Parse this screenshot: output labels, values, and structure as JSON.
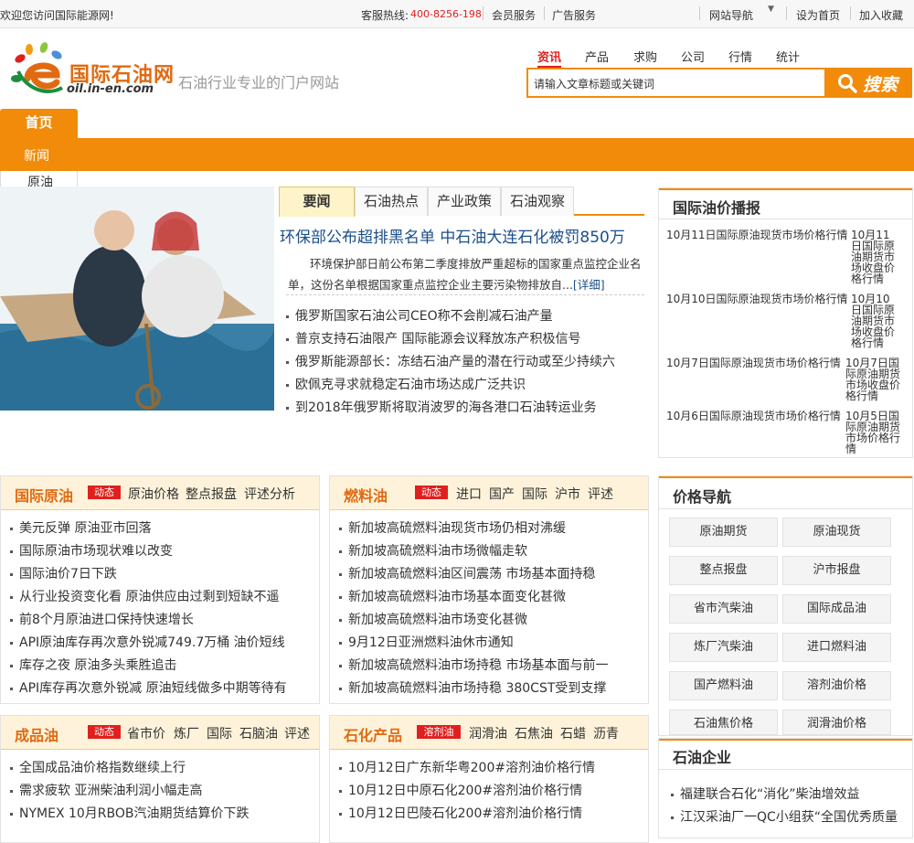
{
  "topbar": {
    "welcome": "欢迎您访问国际能源网!",
    "hotline_label": "客服热线:",
    "hotline": "400-8256-198",
    "member": "会员服务",
    "ads": "广告服务",
    "site_nav": "网站导航",
    "set_home": "设为首页",
    "bookmark": "加入收藏"
  },
  "logo": {
    "name": "国际石油网",
    "domain": "oil.in-en.com"
  },
  "slogan": "石油行业专业的门户网站",
  "search": {
    "tabs": [
      "资讯",
      "产品",
      "求购",
      "公司",
      "行情",
      "统计"
    ],
    "placeholder": "请输入文章标题或关键词",
    "button": "搜索"
  },
  "nav": {
    "home": "首页",
    "sub": [
      "新闻",
      "原油"
    ]
  },
  "headline": {
    "tabs": [
      "要闻",
      "石油热点",
      "产业政策",
      "石油观察"
    ],
    "title": "环保部公布超排黑名单 中石油大连石化被罚850万",
    "summary_line1": "环境保护部日前公布第二季度排放严重超标的国家重点监控企业名",
    "summary_line2": "单，这份名单根据国家重点监控企业主要污染物排放自...",
    "more": "[详细]",
    "items": [
      "俄罗斯国家石油公司CEO称不会削减石油产量",
      "普京支持石油限产 国际能源会议释放冻产积极信号",
      "俄罗斯能源部长：冻结石油产量的潜在行动或至少持续六",
      "欧佩克寻求就稳定石油市场达成广泛共识",
      "到2018年俄罗斯将取消波罗的海各港口石油转运业务"
    ]
  },
  "oil_price_broadcast": {
    "title": "国际油价播报",
    "rows": [
      {
        "left": "10月11日国际原油现货市场价格行情",
        "right": "10月11日国际原油期货市场收盘价格行情"
      },
      {
        "left": "10月10日国际原油现货市场价格行情",
        "right": "10月10日国际原油期货市场收盘价格行情"
      },
      {
        "left": "10月7日国际原油现货市场价格行情",
        "right": "10月7日国际原油期货市场收盘价格行情"
      },
      {
        "left": "10月6日国际原油现货市场价格行情",
        "right": "10月5日国际原油期货市场价格行情"
      }
    ]
  },
  "crude": {
    "title": "国际原油",
    "badge": "动态",
    "links": [
      "原油价格",
      "整点报盘",
      "评述分析"
    ],
    "items": [
      "美元反弹 原油亚市回落",
      "国际原油市场现状难以改变",
      "国际油价7日下跌",
      "从行业投资变化看 原油供应由过剩到短缺不遥",
      "前8个月原油进口保持快速增长",
      "API原油库存再次意外锐减749.7万桶 油价短线",
      "库存之夜 原油多头乘胜追击",
      "API库存再次意外锐减 原油短线做多中期等待有"
    ]
  },
  "fuel": {
    "title": "燃料油",
    "badge": "动态",
    "links": [
      "进口",
      "国产",
      "国际",
      "沪市",
      "评述"
    ],
    "items": [
      "新加坡高硫燃料油现货市场仍相对沸缓",
      "新加坡高硫燃料油市场微幅走软",
      "新加坡高硫燃料油区间震荡 市场基本面持稳",
      "新加坡高硫燃料油市场基本面变化甚微",
      "新加坡高硫燃料油市场变化甚微",
      "9月12日亚洲燃料油休市通知",
      "新加坡高硫燃料油市场持稳 市场基本面与前一",
      "新加坡高硫燃料油市场持稳 380CST受到支撑"
    ]
  },
  "price_nav": {
    "title": "价格导航",
    "buttons": [
      "原油期货",
      "原油现货",
      "整点报盘",
      "沪市报盘",
      "省市汽柴油",
      "国际成品油",
      "炼厂汽柴油",
      "进口燃料油",
      "国产燃料油",
      "溶剂油价格",
      "石油焦价格",
      "润滑油价格"
    ]
  },
  "refined": {
    "title": "成品油",
    "badge": "动态",
    "links": [
      "省市价",
      "炼厂",
      "国际",
      "石脑油",
      "评述"
    ],
    "items": [
      "全国成品油价格指数继续上行",
      "需求疲软 亚洲柴油利润小幅走高",
      "NYMEX 10月RBOB汽油期货结算价下跌"
    ]
  },
  "petrochem": {
    "title": "石化产品",
    "badge": "溶剂油",
    "links": [
      "润滑油",
      "石焦油",
      "石蜡",
      "沥青"
    ],
    "items": [
      "10月12日广东新华粤200#溶剂油价格行情",
      "10月12日中原石化200#溶剂油价格行情",
      "10月12日巴陵石化200#溶剂油价格行情"
    ]
  },
  "companies": {
    "title": "石油企业",
    "items": [
      "福建联合石化“消化”柴油增效益",
      "江汉采油厂一QC小组获“全国优秀质量"
    ]
  },
  "colors": {
    "orange": "#f18b09",
    "red": "#e0201e",
    "panel_bg": "#fef3da",
    "link_blue": "#1a4f8b"
  }
}
